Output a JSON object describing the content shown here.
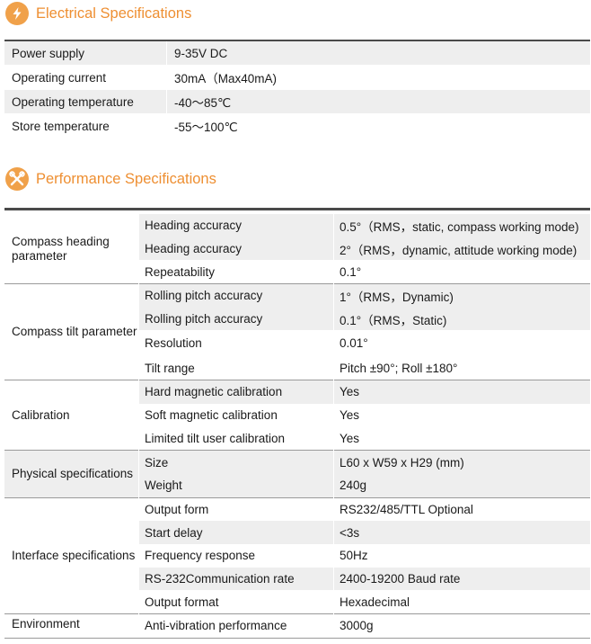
{
  "electrical": {
    "title": "Electrical Specifications",
    "icon": "lightning-icon",
    "accent": "#ee8f32",
    "rows": [
      {
        "label": "Power supply",
        "value": "9-35V DC"
      },
      {
        "label": "Operating  current",
        "value": "30mA（Max40mA)"
      },
      {
        "label": "Operating  temperature",
        "value": "-40～85℃"
      },
      {
        "label": "Store temperature",
        "value": "-55～100℃"
      }
    ]
  },
  "performance": {
    "title": "Performance Specifications",
    "icon": "tools-icon",
    "groups": [
      {
        "name": "Compass heading parameter",
        "rows": [
          {
            "label": "Heading accuracy",
            "value": "0.5°（RMS，static, compass working mode)"
          },
          {
            "label": "Heading accuracy",
            "value": "2°（RMS，dynamic, attitude working mode)"
          },
          {
            "label": "Repeatability",
            "value": "0.1°"
          }
        ]
      },
      {
        "name": "Compass tilt parameter",
        "rows": [
          {
            "label": "Rolling pitch accuracy",
            "value": "1°（RMS，Dynamic)"
          },
          {
            "label": "Rolling pitch accuracy",
            "value": "0.1°（RMS，Static)"
          },
          {
            "label": "Resolution",
            "value": "0.01°"
          },
          {
            "label": "Tilt range",
            "value": "Pitch ±90°;   Roll ±180°"
          }
        ]
      },
      {
        "name": "Calibration",
        "rows": [
          {
            "label": "Hard magnetic calibration",
            "value": "Yes"
          },
          {
            "label": "Soft magnetic calibration",
            "value": "Yes"
          },
          {
            "label": "Limited tilt user calibration",
            "value": "Yes"
          }
        ]
      },
      {
        "name": "Physical specifications",
        "rows": [
          {
            "label": "Size",
            "value": "L60 x W59 x H29 (mm)"
          },
          {
            "label": "Weight",
            "value": "240g"
          }
        ]
      },
      {
        "name": "Interface specifications",
        "rows": [
          {
            "label": "Output form",
            "value": "RS232/485/TTL Optional"
          },
          {
            "label": "Start delay",
            "value": "<3s"
          },
          {
            "label": "Frequency response",
            "value": "50Hz"
          },
          {
            "label": "RS-232Communication rate",
            "value": "2400-19200 Baud rate"
          },
          {
            "label": "Output format",
            "value": "Hexadecimal"
          }
        ]
      },
      {
        "name": "Environment",
        "rows": [
          {
            "label": "Anti-vibration performance",
            "value": "3000g"
          }
        ]
      }
    ]
  }
}
